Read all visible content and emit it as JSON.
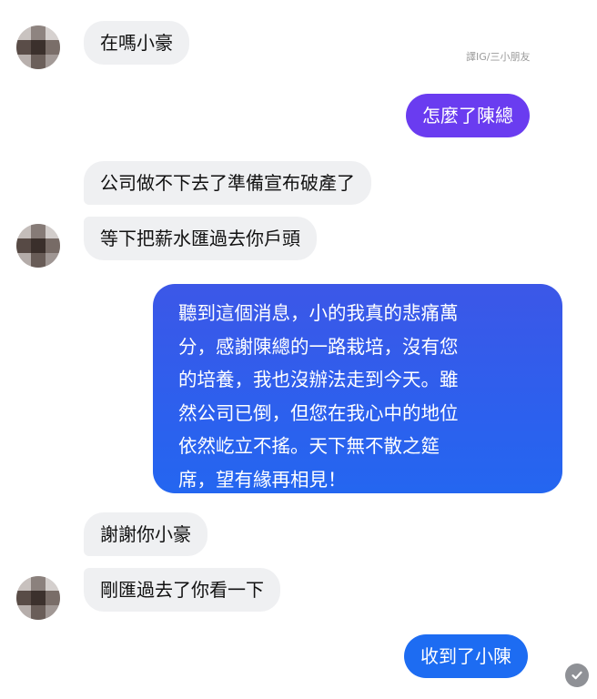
{
  "watermark": "譯IG/三小朋友",
  "messages": [
    {
      "from": "other",
      "text": "在嗎小豪"
    },
    {
      "from": "me",
      "text": "怎麼了陳總"
    },
    {
      "from": "other",
      "text": "公司做不下去了準備宣布破產了"
    },
    {
      "from": "other",
      "text": "等下把薪水匯過去你戶頭"
    },
    {
      "from": "me",
      "lines": [
        "聽到這個消息，小的我真的悲痛萬",
        "分，感謝陳總的一路栽培，沒有您",
        "的培養，我也沒辦法走到今天。雖",
        "然公司已倒，但您在我心中的地位",
        "依然屹立不搖。天下無不散之筵",
        "席，望有緣再相見！"
      ]
    },
    {
      "from": "other",
      "text": "謝謝你小豪"
    },
    {
      "from": "other",
      "text": "剛匯過去了你看一下"
    },
    {
      "from": "me",
      "text": "收到了小陳"
    }
  ],
  "icons": {
    "avatar": "blurred-avatar-icon",
    "seen": "check-circle-icon"
  },
  "colors": {
    "incoming_bubble": "#eff0f2",
    "outgoing_top": "#6a3cf0",
    "outgoing_mid": "#3f54e8",
    "outgoing_bottom": "#1d6cf2",
    "seen_icon": "#8f9196"
  }
}
